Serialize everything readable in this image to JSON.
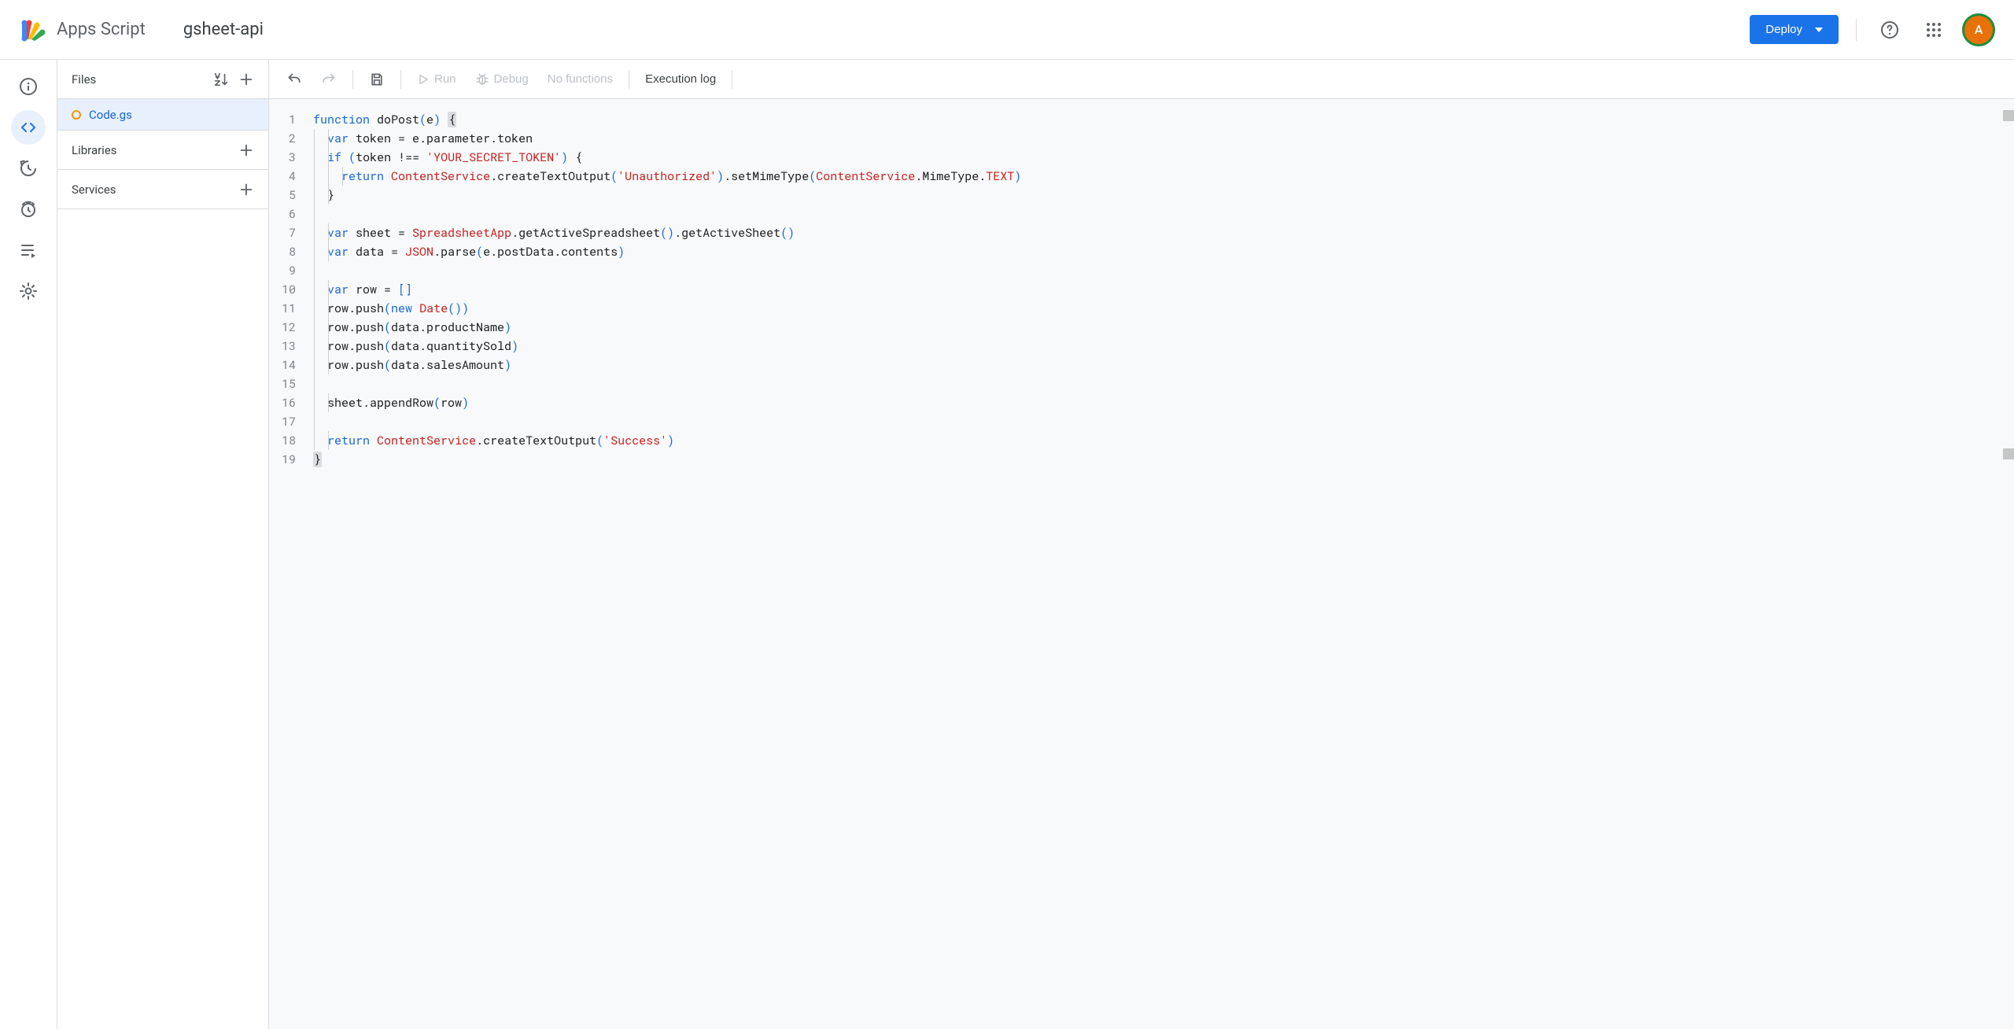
{
  "header": {
    "app_title": "Apps Script",
    "project_name": "gsheet-api",
    "deploy_label": "Deploy",
    "avatar_letter": "A"
  },
  "files_panel": {
    "files_label": "Files",
    "libraries_label": "Libraries",
    "services_label": "Services",
    "file_name": "Code.gs"
  },
  "toolbar": {
    "run_label": "Run",
    "debug_label": "Debug",
    "function_select": "No functions",
    "execution_log_label": "Execution log"
  },
  "code": {
    "lines": [
      [
        {
          "t": "function",
          "c": "kw"
        },
        {
          "t": " doPost"
        },
        {
          "t": "(",
          "c": "paren"
        },
        {
          "t": "e"
        },
        {
          "t": ")",
          "c": "paren"
        },
        {
          "t": " "
        },
        {
          "t": "{",
          "c": "brace-hl"
        }
      ],
      [
        {
          "t": "  "
        },
        {
          "t": "var",
          "c": "kw"
        },
        {
          "t": " token = e.parameter.token"
        }
      ],
      [
        {
          "t": "  "
        },
        {
          "t": "if",
          "c": "kw"
        },
        {
          "t": " "
        },
        {
          "t": "(",
          "c": "paren"
        },
        {
          "t": "token !== "
        },
        {
          "t": "'YOUR_SECRET_TOKEN'",
          "c": "str"
        },
        {
          "t": ")",
          "c": "paren"
        },
        {
          "t": " {"
        }
      ],
      [
        {
          "t": "    "
        },
        {
          "t": "return",
          "c": "kw"
        },
        {
          "t": " "
        },
        {
          "t": "ContentService",
          "c": "id"
        },
        {
          "t": ".createTextOutput"
        },
        {
          "t": "(",
          "c": "paren"
        },
        {
          "t": "'Unauthorized'",
          "c": "str"
        },
        {
          "t": ")",
          "c": "paren"
        },
        {
          "t": ".setMimeType"
        },
        {
          "t": "(",
          "c": "paren"
        },
        {
          "t": "ContentService",
          "c": "id"
        },
        {
          "t": ".MimeType."
        },
        {
          "t": "TEXT",
          "c": "id"
        },
        {
          "t": ")",
          "c": "paren"
        }
      ],
      [
        {
          "t": "  }"
        }
      ],
      [
        {
          "t": ""
        }
      ],
      [
        {
          "t": "  "
        },
        {
          "t": "var",
          "c": "kw"
        },
        {
          "t": " sheet = "
        },
        {
          "t": "SpreadsheetApp",
          "c": "id"
        },
        {
          "t": ".getActiveSpreadsheet"
        },
        {
          "t": "()",
          "c": "paren"
        },
        {
          "t": ".getActiveSheet"
        },
        {
          "t": "()",
          "c": "paren"
        }
      ],
      [
        {
          "t": "  "
        },
        {
          "t": "var",
          "c": "kw"
        },
        {
          "t": " data = "
        },
        {
          "t": "JSON",
          "c": "id"
        },
        {
          "t": ".parse"
        },
        {
          "t": "(",
          "c": "paren"
        },
        {
          "t": "e.postData.contents"
        },
        {
          "t": ")",
          "c": "paren"
        }
      ],
      [
        {
          "t": ""
        }
      ],
      [
        {
          "t": "  "
        },
        {
          "t": "var",
          "c": "kw"
        },
        {
          "t": " row = "
        },
        {
          "t": "[]",
          "c": "paren"
        }
      ],
      [
        {
          "t": "  row.push"
        },
        {
          "t": "(",
          "c": "paren"
        },
        {
          "t": "new",
          "c": "kw"
        },
        {
          "t": " "
        },
        {
          "t": "Date",
          "c": "id"
        },
        {
          "t": "()",
          "c": "paren"
        },
        {
          "t": ")",
          "c": "paren"
        }
      ],
      [
        {
          "t": "  row.push"
        },
        {
          "t": "(",
          "c": "paren"
        },
        {
          "t": "data.productName"
        },
        {
          "t": ")",
          "c": "paren"
        }
      ],
      [
        {
          "t": "  row.push"
        },
        {
          "t": "(",
          "c": "paren"
        },
        {
          "t": "data.quantitySold"
        },
        {
          "t": ")",
          "c": "paren"
        }
      ],
      [
        {
          "t": "  row.push"
        },
        {
          "t": "(",
          "c": "paren"
        },
        {
          "t": "data.salesAmount"
        },
        {
          "t": ")",
          "c": "paren"
        }
      ],
      [
        {
          "t": ""
        }
      ],
      [
        {
          "t": "  sheet.appendRow"
        },
        {
          "t": "(",
          "c": "paren"
        },
        {
          "t": "row"
        },
        {
          "t": ")",
          "c": "paren"
        }
      ],
      [
        {
          "t": ""
        }
      ],
      [
        {
          "t": "  "
        },
        {
          "t": "return",
          "c": "kw"
        },
        {
          "t": " "
        },
        {
          "t": "ContentService",
          "c": "id"
        },
        {
          "t": ".createTextOutput"
        },
        {
          "t": "(",
          "c": "paren"
        },
        {
          "t": "'Success'",
          "c": "str"
        },
        {
          "t": ")",
          "c": "paren"
        }
      ],
      [
        {
          "t": "}",
          "c": "brace-hl"
        }
      ]
    ]
  }
}
